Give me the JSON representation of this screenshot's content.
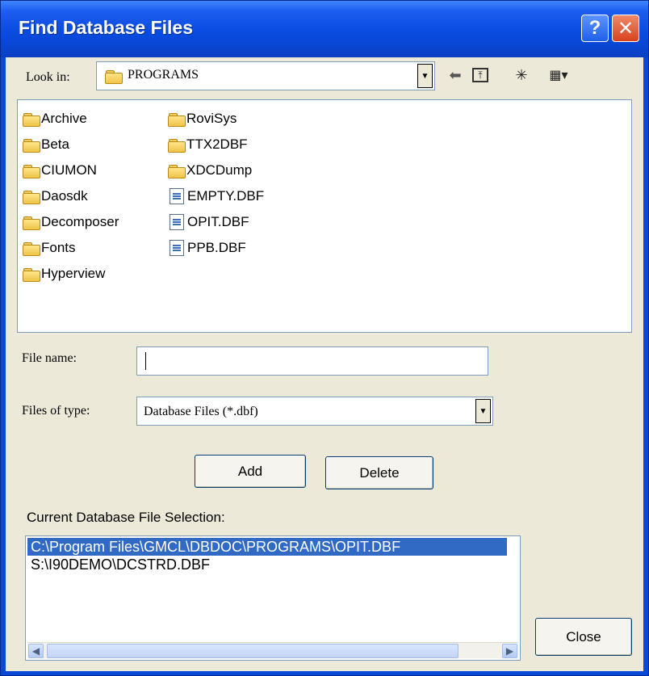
{
  "window": {
    "title": "Find Database Files"
  },
  "lookin": {
    "label": "Look in:",
    "value": "PROGRAMS"
  },
  "files": {
    "col1": [
      "Archive",
      "Beta",
      "CIUMON",
      "Daosdk",
      "Decomposer",
      "Fonts",
      "Hyperview"
    ],
    "col2_folders": [
      "RoviSys",
      "TTX2DBF",
      "XDCDump"
    ],
    "col2_files": [
      "EMPTY.DBF",
      "OPIT.DBF",
      "PPB.DBF"
    ]
  },
  "filename": {
    "label": "File name:",
    "value": ""
  },
  "filetype": {
    "label": "Files of type:",
    "value": "Database Files (*.dbf)"
  },
  "buttons": {
    "add": "Add",
    "delete": "Delete",
    "close": "Close"
  },
  "selection": {
    "label": "Current Database File Selection:",
    "items": [
      "C:\\Program Files\\GMCL\\DBDOC\\PROGRAMS\\OPIT.DBF",
      "S:\\I90DEMO\\DCSTRD.DBF"
    ]
  }
}
